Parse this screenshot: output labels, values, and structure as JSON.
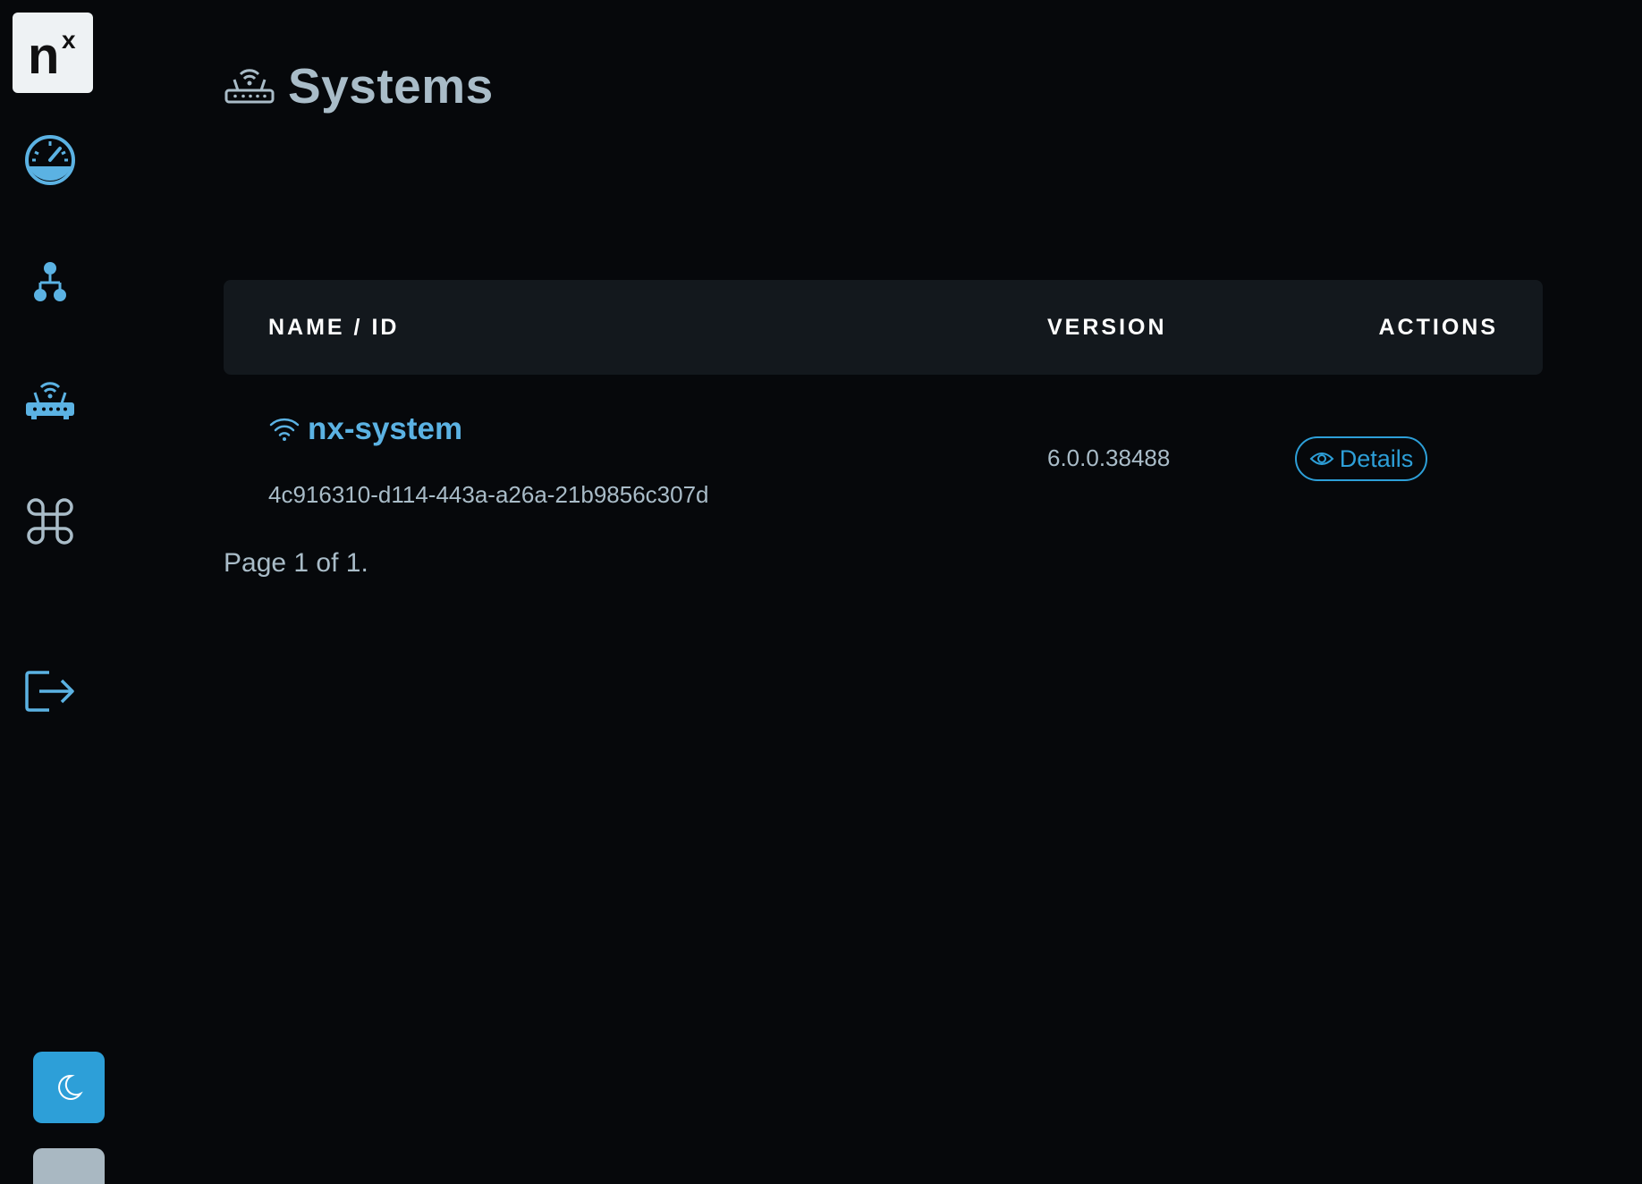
{
  "logo": {
    "text": "n",
    "superscript": "x"
  },
  "sidebar": {
    "items": [
      {
        "name": "dashboard",
        "icon": "gauge-icon"
      },
      {
        "name": "topology",
        "icon": "sitemap-icon"
      },
      {
        "name": "systems",
        "icon": "router-icon"
      },
      {
        "name": "commands",
        "icon": "command-icon"
      },
      {
        "name": "logout",
        "icon": "logout-icon"
      }
    ],
    "theme_toggle_icon": "moon-icon"
  },
  "header": {
    "title": "Systems",
    "icon": "router-icon"
  },
  "table": {
    "columns": [
      "NAME / ID",
      "VERSION",
      "ACTIONS"
    ],
    "rows": [
      {
        "name": "nx-system",
        "status_icon": "wifi-icon",
        "id": "4c916310-d114-443a-a26a-21b9856c307d",
        "version": "6.0.0.38488",
        "action_label": "Details",
        "action_icon": "eye-icon"
      }
    ]
  },
  "pagination": {
    "text": "Page 1 of 1."
  },
  "colors": {
    "accent": "#2d9fd8",
    "link": "#5bb2e3",
    "muted_text": "#a9bcc8",
    "background": "#06080b",
    "table_header_bg": "#13181d"
  }
}
